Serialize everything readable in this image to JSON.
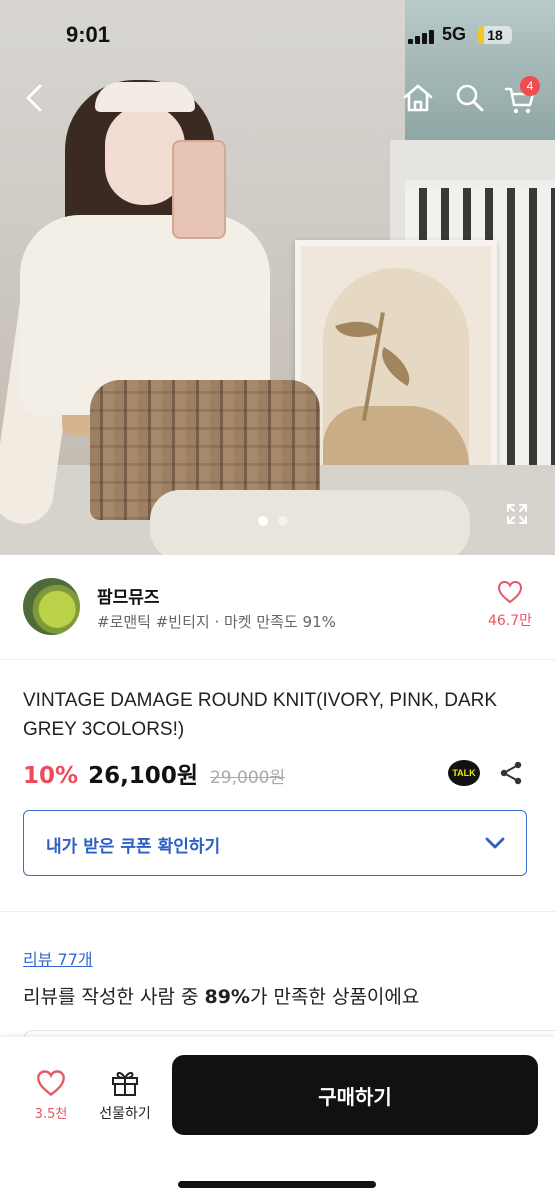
{
  "status_bar": {
    "time": "9:01",
    "network": "5G",
    "battery": "18",
    "battery_level": 0.18
  },
  "header": {
    "cart_badge": "4"
  },
  "gallery": {
    "total_images": 2,
    "active_index": 0
  },
  "seller": {
    "name": "팜므뮤즈",
    "tags": "#로맨틱 #빈티지 · 마켓 만족도 91%",
    "like_count": "46.7만"
  },
  "product": {
    "title": "VINTAGE DAMAGE ROUND KNIT(IVORY, PINK, DARK GREY 3COLORS!)",
    "discount": "10%",
    "price": "26,100원",
    "original_price": "29,000원",
    "talk_label": "TALK"
  },
  "coupon": {
    "label": "내가 받은 쿠폰 확인하기"
  },
  "review": {
    "link": "리뷰 77개",
    "summary_prefix": "리뷰를 작성한 사람 중 ",
    "summary_highlight": "89%",
    "summary_suffix": "가 만족한 상품이에요"
  },
  "bottom_bar": {
    "like_count": "3.5천",
    "gift_label": "선물하기",
    "buy_label": "구매하기"
  },
  "colors": {
    "accent_red": "#ee4a5c",
    "link_blue": "#3568cc",
    "buy_button": "#111111"
  }
}
